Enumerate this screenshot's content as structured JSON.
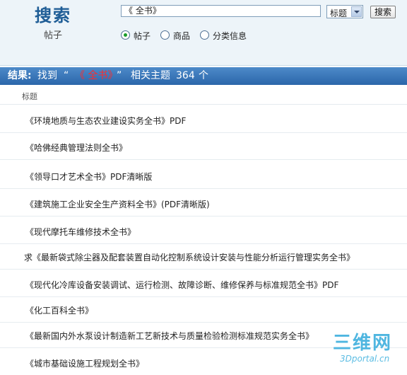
{
  "search": {
    "title": "搜索",
    "subtitle": "帖子",
    "query_value": "《     全书》",
    "scope_value": "标题",
    "button_label": "搜索",
    "radio_options": [
      {
        "label": "帖子",
        "checked": true
      },
      {
        "label": "商品",
        "checked": false
      },
      {
        "label": "分类信息",
        "checked": false
      }
    ]
  },
  "result": {
    "prefix": "结果:",
    "found_text": "找到",
    "open_quote": "“",
    "keyword": "《 全书》",
    "close_quote": "”",
    "suffix": "相关主题",
    "count": "364",
    "unit": "个"
  },
  "table": {
    "column_header": "标题",
    "rows": [
      "《环境地质与生态农业建设实务全书》PDF",
      "《哈佛经典管理法则全书》",
      "《领导口才艺术全书》PDF清晰版",
      "《建筑施工企业安全生产资料全书》(PDF清晰版)",
      "《现代摩托车维修技术全书》",
      "求《最新袋式除尘器及配套装置自动化控制系统设计安装与性能分析运行管理实务全书》",
      "《现代化冷库设备安装调试、运行检测、故障诊断、维修保养与标准规范全书》PDF",
      "《化工百科全书》",
      "《最新国内外水泵设计制造新工艺新技术与质量检验检测标准规范实务全书》",
      "《城市基础设施工程规划全书》"
    ]
  },
  "watermark": {
    "logo": "三维网",
    "url": "3Dportal.cn"
  },
  "colors": {
    "header_bar": "#2b66aa",
    "keyword_red": "#ff2a2a",
    "title_blue": "#1f5d96",
    "radio_green": "#1a9c2a"
  }
}
